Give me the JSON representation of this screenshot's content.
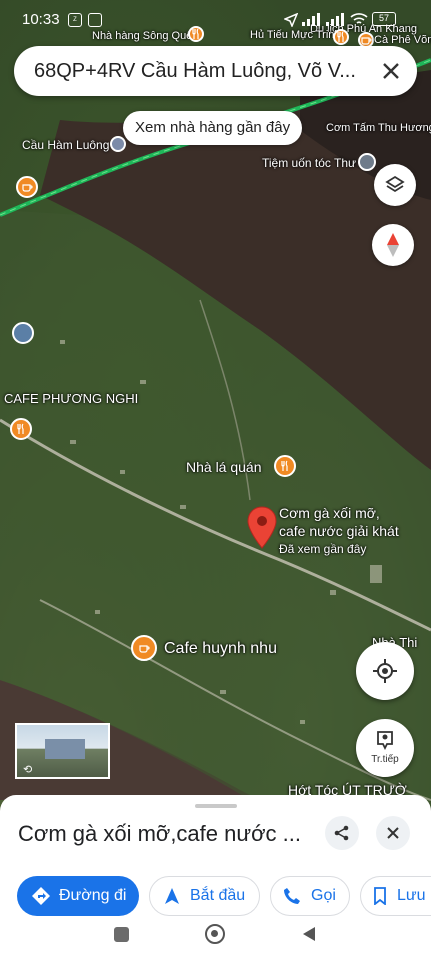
{
  "status_bar": {
    "time": "10:33",
    "battery": "57"
  },
  "search": {
    "query": "68QP+4RV Cầu Hàm Luông, Võ V..."
  },
  "nearby_chip": {
    "label": "Xem nhà hàng gần đây"
  },
  "map_labels": {
    "nha_hang_song_que": "Nhà hàng Sông Quê",
    "du_lich_phu_an_khang": "Du lịch Phú An Khang",
    "hu_tieu_muc_trinh": "Hủ Tiếu Mực Trinh",
    "ca_phe_vong": "Cà Phê Võng",
    "cau_ham_luong": "Cầu Hàm Luông",
    "com_tam_thu_huong": "Cơm Tấm Thu Hương",
    "tiem_uon_toc_thu": "Tiệm uốn tóc Thư",
    "cafe_phuong_nghi": "CAFE PHƯƠNG NGHI",
    "nha_la_quan": "Nhà lá quán",
    "selected_place": "Cơm gà xối mỡ,\ncafe nước giải khát",
    "viewed_recently": "Đã xem gần đây",
    "cafe_huynh_nhu": "Cafe huynh nhu",
    "nha_thi": "Nhà Thi",
    "hot_toc": "Hớt Tóc ÚT TRƯỜ"
  },
  "controls": {
    "directions_fab_label": "Tr.tiếp"
  },
  "place_sheet": {
    "title": "Cơm gà xối mỡ,cafe nước ...",
    "actions": {
      "directions": "Đường đi",
      "start": "Bắt đầu",
      "call": "Gọi",
      "save": "Lưu"
    }
  },
  "colors": {
    "accent": "#1a73e8",
    "poi_orange": "#f08a24",
    "pin_red": "#ea4335",
    "road_green": "#1fb85a"
  }
}
